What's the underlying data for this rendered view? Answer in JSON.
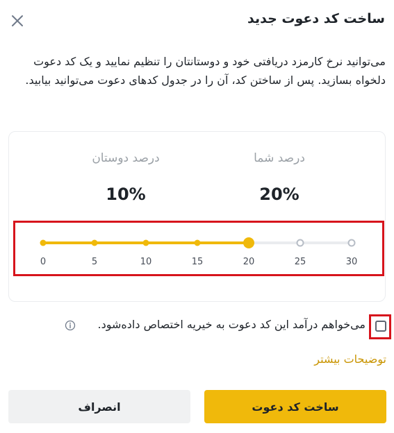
{
  "modal": {
    "title": "ساخت کد دعوت جدید",
    "description": "می‌توانید نرخ کارمزد دریافتی خود و دوستانتان را تنظیم نمایید و یک کد دعوت دلخواه بسازید. پس از ساختن کد، آن را در جدول کدهای دعوت می‌توانید بیابید."
  },
  "commission": {
    "your_label": "درصد شما",
    "your_value": "20%",
    "friends_label": "درصد دوستان",
    "friends_value": "10%"
  },
  "slider": {
    "ticks": [
      "0",
      "5",
      "10",
      "15",
      "20",
      "25",
      "30"
    ],
    "selected_value": 20,
    "max": 30,
    "active_color": "#f0b90b",
    "inactive_color": "#eaecef"
  },
  "charity": {
    "label": "می‌خواهم درآمد این کد دعوت به خیریه اختصاص داده‌شود.",
    "checked": false
  },
  "links": {
    "more": "توضیحات بیشتر"
  },
  "buttons": {
    "create": "ساخت کد دعوت",
    "cancel": "انصراف"
  },
  "icons": {
    "close": "close-icon",
    "info": "info-icon"
  }
}
